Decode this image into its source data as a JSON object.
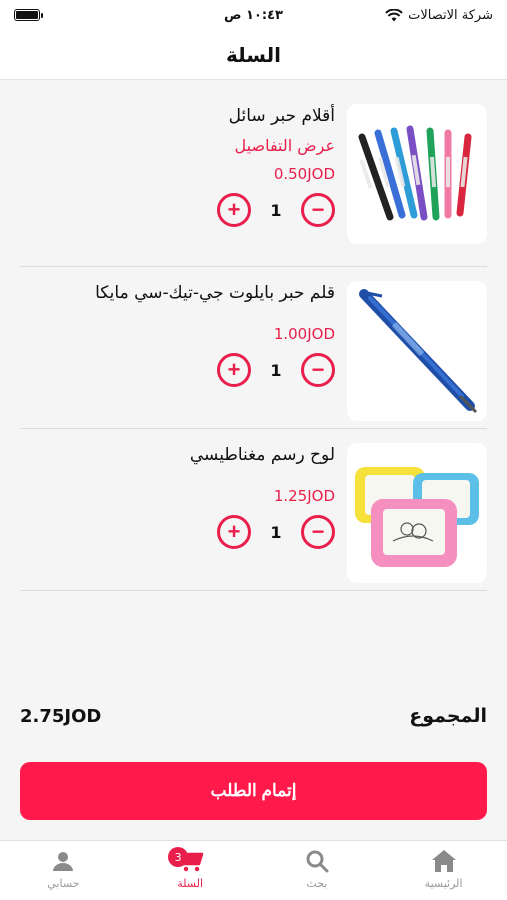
{
  "status_bar": {
    "time": "١٠:٤٣ ص",
    "carrier": "شركة الاتصالات"
  },
  "header": {
    "title": "السلة"
  },
  "cart": {
    "items": [
      {
        "name": "أقلام حبر سائل",
        "details_link": "عرض التفاصيل",
        "price": "0.50JOD",
        "quantity": "1",
        "icon": "pens-image"
      },
      {
        "name": "قلم حبر بايلوت جي-تيك-سي مايكا",
        "price": "1.00JOD",
        "quantity": "1",
        "icon": "blue-pen-image"
      },
      {
        "name": "لوح رسم مغناطيسي",
        "price": "1.25JOD",
        "quantity": "1",
        "icon": "drawing-board-image"
      }
    ]
  },
  "total": {
    "label": "المجموع",
    "amount": "2.75JOD"
  },
  "checkout": {
    "label": "إتمام الطلب"
  },
  "tab_bar": {
    "tabs": [
      {
        "label": "الرئيسية",
        "icon": "home-icon"
      },
      {
        "label": "بحث",
        "icon": "search-icon"
      },
      {
        "label": "السلة",
        "icon": "cart-icon",
        "badge": "3",
        "active": true
      },
      {
        "label": "حسابي",
        "icon": "user-icon"
      }
    ]
  },
  "colors": {
    "accent": "#e91e4b",
    "checkout_bg": "#ff1a4b"
  }
}
